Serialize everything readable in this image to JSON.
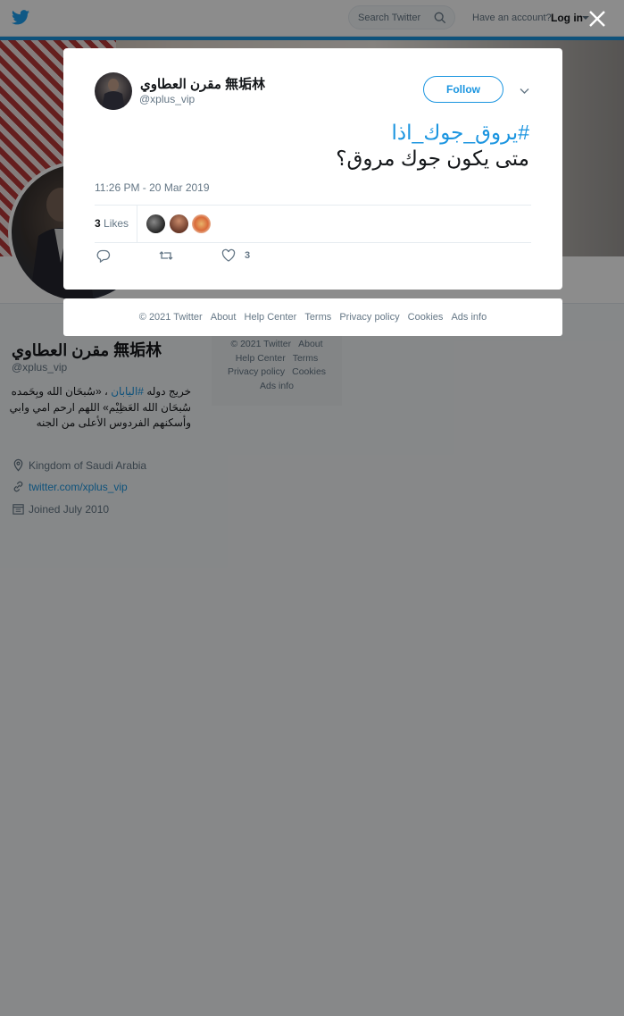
{
  "topbar": {
    "search_placeholder": "Search Twitter",
    "have_account": "Have an account?",
    "login": "Log in"
  },
  "profile": {
    "name": "مقرن العطاوي 無垢林",
    "handle": "@xplus_vip",
    "bio_part1": "خريج دوله",
    "bio_hashtag": "#اليابان",
    "bio_part2": "، «سُبحَان الله وبِحَمده سُبحَان الله العَظِيْم» اللهم ارحم امي وابي وأسكنهم الفردوس الأعلى من الجنه",
    "location": "Kingdom of Saudi Arabia",
    "url": "twitter.com/xplus_vip",
    "joined": "Joined July 2010"
  },
  "sidebar_footer": {
    "copyright": "© 2021 Twitter",
    "about": "About",
    "help": "Help Center",
    "terms": "Terms",
    "privacy": "Privacy policy",
    "cookies": "Cookies",
    "ads": "Ads info"
  },
  "tweet": {
    "author_name": "مقرن العطاوي 無垢林",
    "author_handle": "@xplus_vip",
    "follow_label": "Follow",
    "hashtag": "#يروق_جوك_اذا",
    "text": "متى يكون جوك مروق؟",
    "timestamp": "11:26 PM - 20 Mar 2019",
    "likes_count": "3",
    "likes_label": "Likes",
    "like_action_count": "3"
  },
  "modal_footer": {
    "copyright": "© 2021 Twitter",
    "about": "About",
    "help": "Help Center",
    "terms": "Terms",
    "privacy": "Privacy policy",
    "cookies": "Cookies",
    "ads": "Ads info"
  },
  "colors": {
    "twitter_blue": "#1b95e0",
    "text_primary": "#14171a",
    "text_secondary": "#657786"
  },
  "icons": {
    "bird": "twitter-bird-icon",
    "search": "search-icon",
    "close": "close-icon",
    "chevron": "chevron-down-icon",
    "reply": "reply-icon",
    "retweet": "retweet-icon",
    "like": "heart-icon",
    "location": "location-pin-icon",
    "link": "link-icon",
    "calendar": "calendar-icon"
  }
}
